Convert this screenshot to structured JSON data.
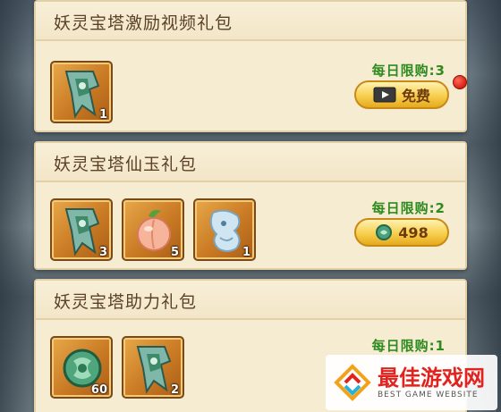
{
  "cards": [
    {
      "title": "妖灵宝塔激励视频礼包",
      "items": [
        {
          "icon": "banner-flag-icon",
          "count": "1"
        }
      ],
      "limit": "每日限购:3",
      "button": {
        "icon": "video-play-icon",
        "label": "免费"
      },
      "has_red_dot": true
    },
    {
      "title": "妖灵宝塔仙玉礼包",
      "items": [
        {
          "icon": "banner-flag-icon",
          "count": "3"
        },
        {
          "icon": "peach-icon",
          "count": "5"
        },
        {
          "icon": "water-spirit-icon",
          "count": "1"
        }
      ],
      "limit": "每日限购:2",
      "button": {
        "icon": "jade-coin-icon",
        "label": "498"
      }
    },
    {
      "title": "妖灵宝塔助力礼包",
      "items": [
        {
          "icon": "jade-dragon-icon",
          "count": "60"
        },
        {
          "icon": "banner-flag-icon",
          "count": "2"
        }
      ],
      "limit": "每日限购:1"
    }
  ],
  "watermark": {
    "main": "最佳游戏网",
    "sub": "BEST GAME WEBSITE"
  },
  "colors": {
    "card_bg": "#f6ecd2",
    "title": "#5b4125",
    "limit": "#2f8a1f",
    "button_gold": "#f7cf4e",
    "red_dot": "#d91f12",
    "watermark_red": "#e0231e"
  }
}
